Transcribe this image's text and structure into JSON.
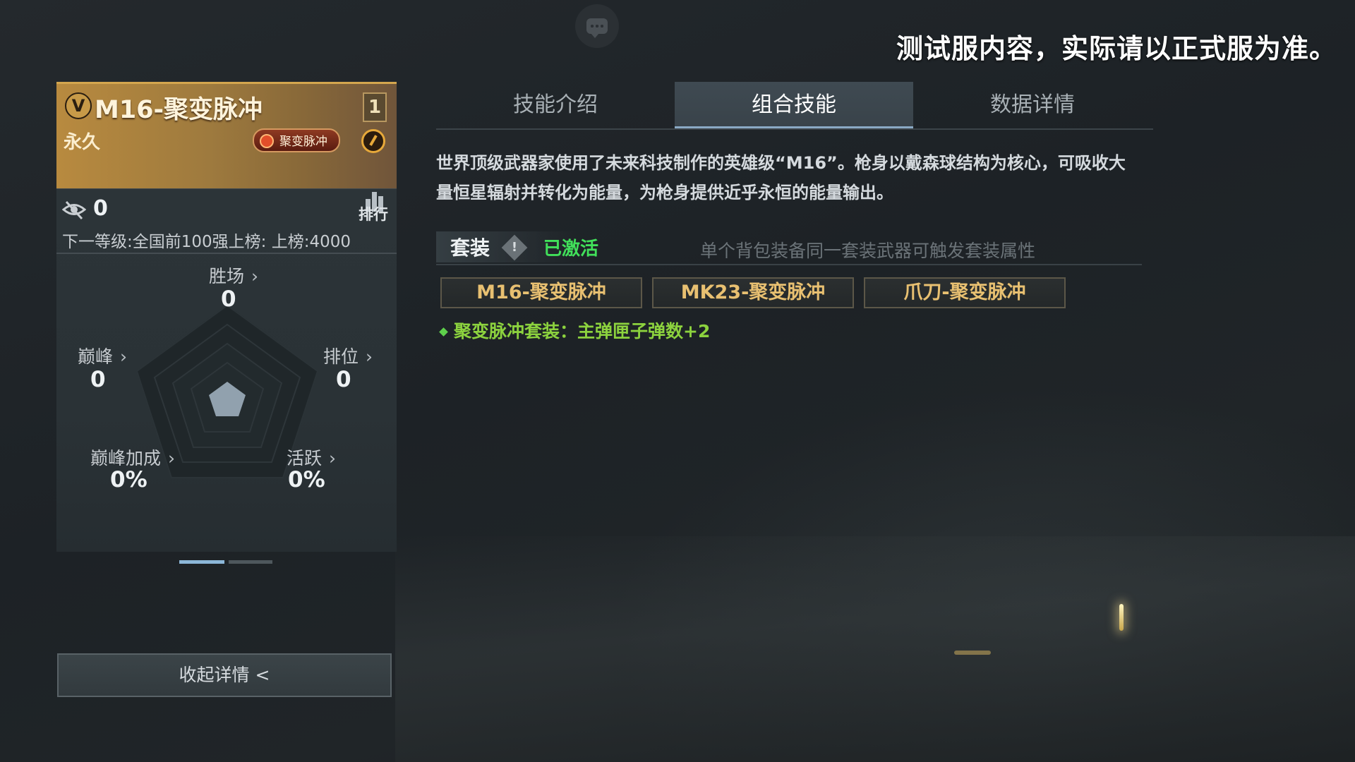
{
  "notice": "测试服内容，实际请以正式服为准。",
  "card": {
    "badge_letter": "V",
    "weapon_name": "M16-聚变脉冲",
    "rank_number": "1",
    "duration": "永久",
    "tag_label": "聚变脉冲",
    "score": "0",
    "rank_label": "排行",
    "next_level": "下一等级:全国前100强上榜: 上榜:4000",
    "stats": {
      "wins": {
        "label": "胜场",
        "value": "0"
      },
      "peak": {
        "label": "巅峰",
        "value": "0"
      },
      "ranked": {
        "label": "排位",
        "value": "0"
      },
      "peak_bonus": {
        "label": "巅峰加成",
        "value": "0%"
      },
      "active": {
        "label": "活跃",
        "value": "0%"
      }
    },
    "collapse_label": "收起详情 <"
  },
  "tabs": [
    {
      "label": "技能介绍",
      "active": false
    },
    {
      "label": "组合技能",
      "active": true
    },
    {
      "label": "数据详情",
      "active": false
    }
  ],
  "description": "世界顶级武器家使用了未来科技制作的英雄级“M16”。枪身以戴森球结构为核心，可吸收大量恒星辐射并转化为能量，为枪身提供近乎永恒的能量输出。",
  "set": {
    "label": "套装",
    "warn_glyph": "!",
    "status": "已激活",
    "hint": "单个背包装备同一套装武器可触发套装属性",
    "pieces": [
      "M16-聚变脉冲",
      "MK23-聚变脉冲",
      "爪刀-聚变脉冲"
    ],
    "bonus": "聚变脉冲套装：主弹匣子弹数+2"
  },
  "colors": {
    "accent_gold": "#b88a3f",
    "active_green": "#41e05a",
    "bonus_green": "#8cd23e",
    "piece_text": "#e8c071"
  }
}
